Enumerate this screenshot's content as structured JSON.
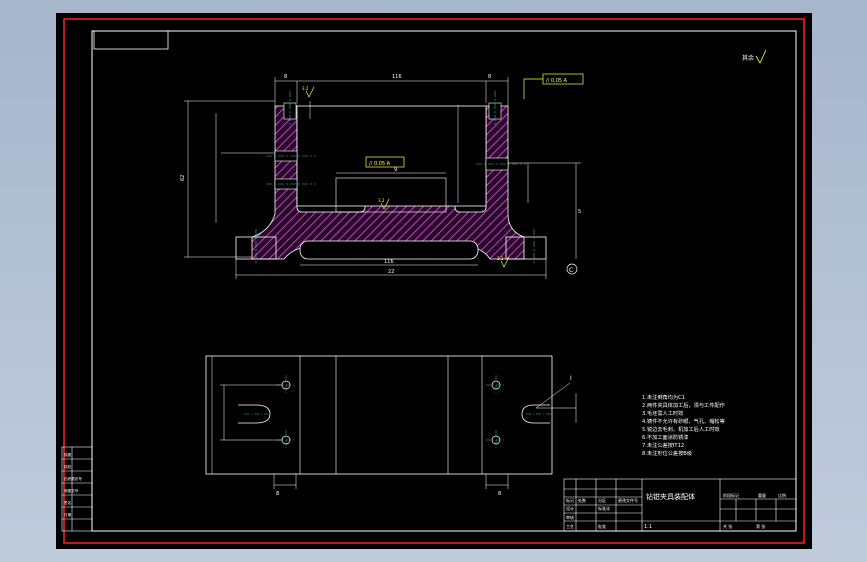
{
  "drawing": {
    "top_dims": {
      "left_edge": "8",
      "width": "116",
      "right_edge": "8",
      "height": "62",
      "base_inner": "116",
      "base_total": "22",
      "slot_width": "9",
      "right_height": "5"
    },
    "datum_label": "C",
    "flatness_callout_1": "// 0.05 A",
    "flatness_callout_2": "// 0.05 A",
    "roughness": [
      "3.2",
      "3.2",
      "3.2",
      "3.2"
    ],
    "surface_note": "其余",
    "leader_label": "I",
    "bottom_dims": {
      "a": "8",
      "b": "8"
    },
    "tech_notes": [
      "1.未注倒角均为C1",
      "2.两件夹具体加工后，须与工件配作",
      "3.毛坯需人工时效",
      "4.铸件不允许有砂眼、气孔、缩松等",
      "5.锐边去毛刺，机加工后人工时效",
      "6.不加工面涂防锈漆",
      "7.未注公差按IT12",
      "8.未注形位公差按B级"
    ],
    "title_block": {
      "drawing_name": "钻钳夹具装配体",
      "labels": [
        "标记",
        "处数",
        "分区",
        "更改文件号",
        "签名",
        "年月日",
        "设计",
        "标准化",
        "审核",
        "工艺",
        "批准"
      ],
      "extras": [
        "阶段标记",
        "重量",
        "比例",
        "共 张",
        "第 张"
      ],
      "scale": "1:1"
    },
    "side_table": [
      "描图",
      "描校",
      "旧底图总号",
      "底图总号",
      "签名",
      "日期"
    ]
  }
}
